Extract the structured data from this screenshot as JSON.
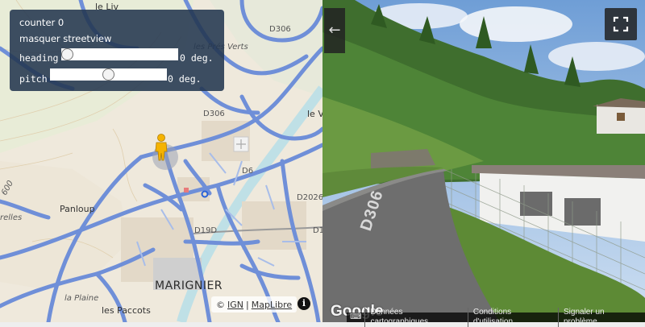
{
  "panel": {
    "counter_label": "counter 0",
    "toggle_label": "masquer streetview",
    "heading_label": "heading",
    "heading_value": "0 deg.",
    "heading_level": 0,
    "pitch_label": "pitch",
    "pitch_value": "0 deg.",
    "pitch_level": 0.5
  },
  "map": {
    "labels": {
      "le_liv": "le Liv",
      "d306_top": "D306",
      "les_pres_verts": "les Prés Verts",
      "d306_mid": "D306",
      "le_v": "le V",
      "d6": "D6",
      "d2026": "D2026",
      "panloup": "Panloup",
      "relles": "relles",
      "d19d": "D19D",
      "d1": "D1",
      "town": "MARIGNIER",
      "la_plaine": "la Plaine",
      "les_paccots": "les Paccots",
      "contour_600": "600"
    },
    "attribution": {
      "copyright": "©",
      "ign": "IGN",
      "separator": "|",
      "maplibre": "MapLibre",
      "info": "i"
    }
  },
  "streetview": {
    "road_marking": "D306",
    "google_logo": "Google",
    "footer": {
      "map_data": "Données cartographiques",
      "terms": "Conditions d'utilisation",
      "report": "Signaler un problème"
    },
    "back_icon": "arrow-left-icon",
    "fullscreen_icon": "fullscreen-icon"
  }
}
